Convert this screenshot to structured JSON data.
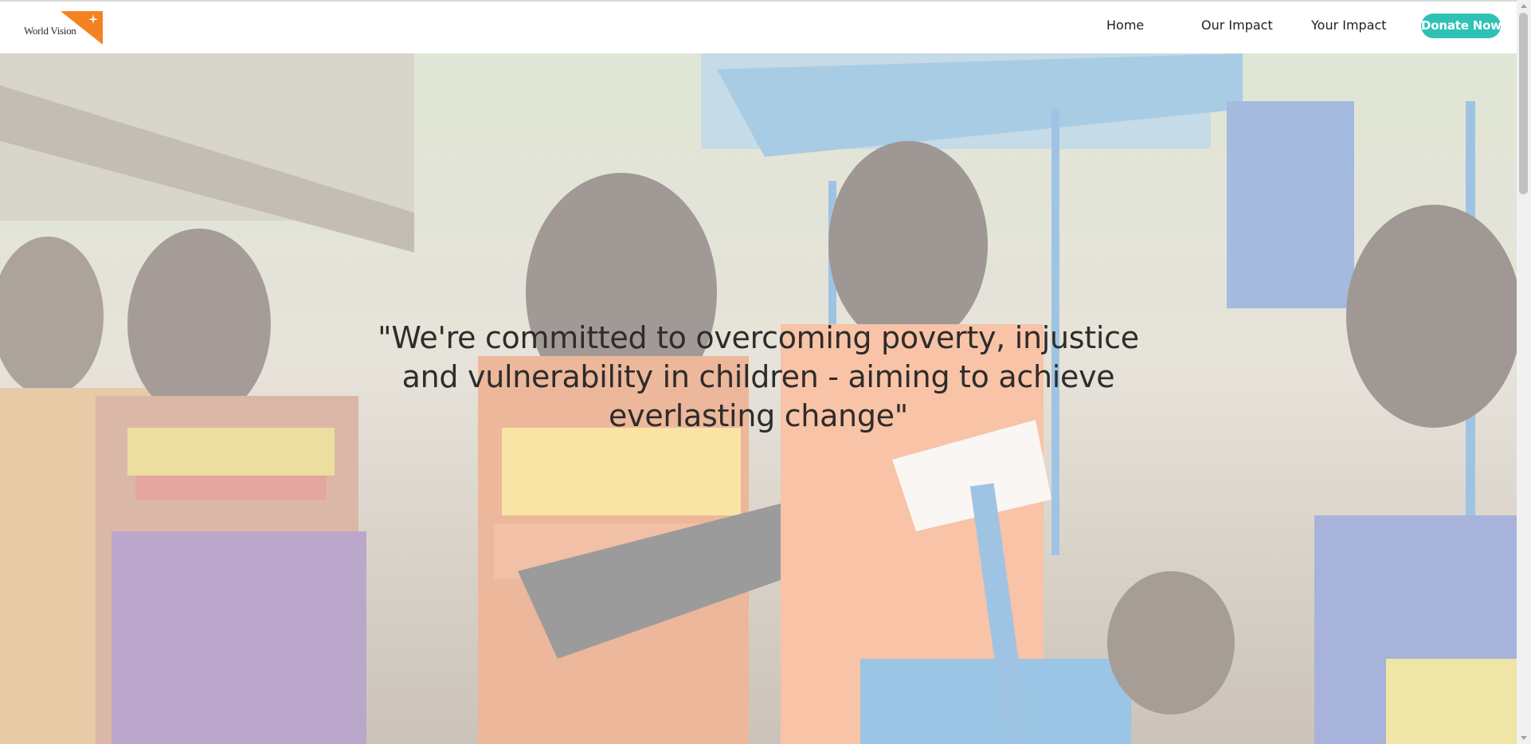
{
  "brand": {
    "logo_text": "World Vision",
    "logo_color": "#f58220"
  },
  "nav": {
    "items": [
      {
        "label": "Home"
      },
      {
        "label": "Our Impact"
      },
      {
        "label": "Your Impact"
      }
    ],
    "cta_label": "Donate Now",
    "cta_color": "#2ec2b5"
  },
  "hero": {
    "quote": "\"We're committed to overcoming poverty, injustice and vulnerability in children - aiming to achieve everlasting change\"",
    "image_desc_icon": "hero-photo"
  }
}
